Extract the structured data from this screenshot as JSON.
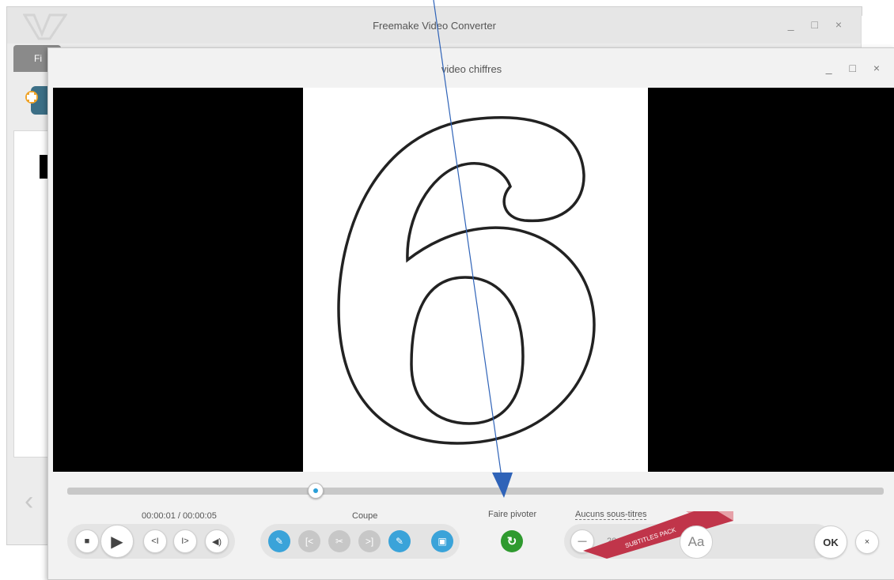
{
  "main_window": {
    "title": "Freemake Video Converter",
    "controls": "_ □ ×",
    "tab_label": "Fi"
  },
  "dialog": {
    "title": "video chiffres",
    "controls": "_ □ ×"
  },
  "player": {
    "time": "00:00:01 / 00:00:05",
    "progress_fraction": 0.31
  },
  "labels": {
    "cut": "Coupe",
    "rotate": "Faire pivoter",
    "subtitles": "Aucuns sous-titres",
    "subtitle_size": "20",
    "subtitles_pack": "SUBTITLES PACK",
    "aa": "Aa",
    "ok": "OK",
    "close": "×"
  },
  "icons": {
    "stop": "■",
    "play": "▶",
    "prev_frame": "<I",
    "next_frame": "I>",
    "volume": "◀)",
    "minus": "—",
    "rotate": "↻"
  },
  "colors": {
    "accent_blue": "#3aa3d9",
    "rotate_green": "#2f9a2f",
    "ribbon_red": "#c0354a",
    "arrow_blue": "#2f63b8"
  }
}
